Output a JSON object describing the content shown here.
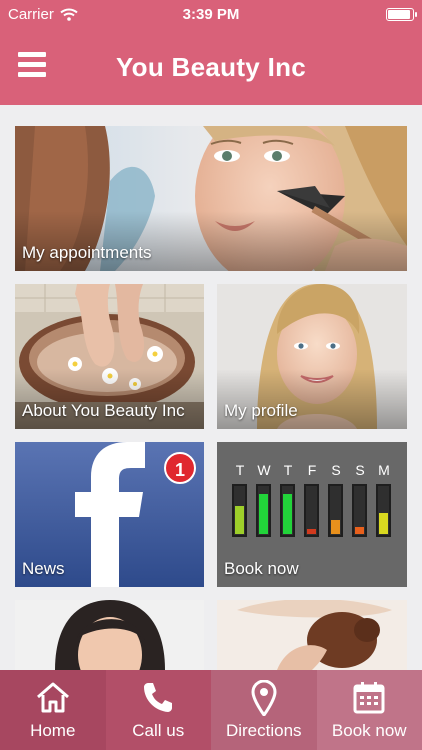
{
  "status_bar": {
    "carrier": "Carrier",
    "time": "3:39 PM"
  },
  "nav": {
    "title": "You Beauty Inc"
  },
  "tiles": {
    "appointments": {
      "label": "My appointments"
    },
    "about": {
      "label": "About You Beauty Inc"
    },
    "profile": {
      "label": "My profile"
    },
    "news": {
      "label": "News",
      "badge": "1"
    },
    "book": {
      "label": "Book now",
      "days": [
        "T",
        "W",
        "T",
        "F",
        "S",
        "S",
        "M"
      ],
      "availability": [
        0.6,
        0.85,
        0.85,
        0.1,
        0.3,
        0.15,
        0.45
      ],
      "level_colors": [
        "#9ecf2a",
        "#22d43a",
        "#22d43a",
        "#d13a1e",
        "#e8901c",
        "#e8601c",
        "#d8d820"
      ]
    }
  },
  "tabs": [
    {
      "label": "Home",
      "icon": "home-icon"
    },
    {
      "label": "Call us",
      "icon": "phone-icon"
    },
    {
      "label": "Directions",
      "icon": "map-pin-icon"
    },
    {
      "label": "Book now",
      "icon": "calendar-icon"
    }
  ],
  "colors": {
    "brand": "#d96179",
    "tab_home": "#a74760",
    "tab_call": "#b24f68",
    "tab_directions": "#b5647a",
    "tab_book": "#c07489"
  }
}
